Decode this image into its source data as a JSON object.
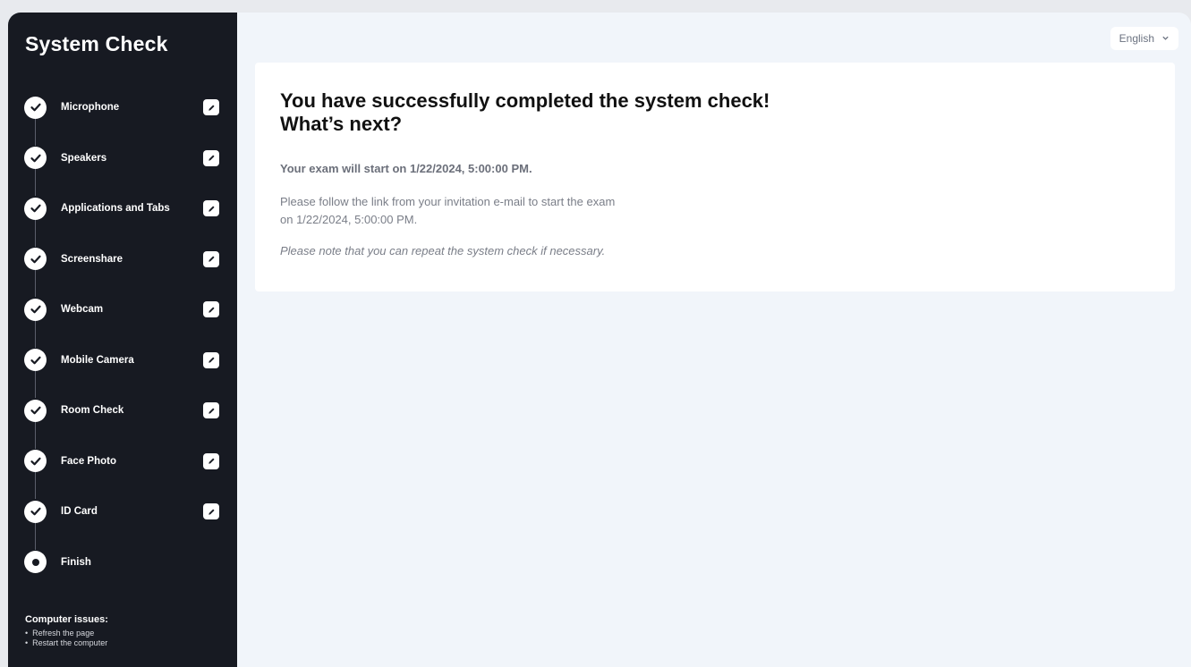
{
  "sidebar": {
    "title": "System Check",
    "steps": [
      {
        "label": "Microphone",
        "status": "done"
      },
      {
        "label": "Speakers",
        "status": "done"
      },
      {
        "label": "Applications and Tabs",
        "status": "done"
      },
      {
        "label": "Screenshare",
        "status": "done"
      },
      {
        "label": "Webcam",
        "status": "done"
      },
      {
        "label": "Mobile Camera",
        "status": "done"
      },
      {
        "label": "Room Check",
        "status": "done"
      },
      {
        "label": "Face Photo",
        "status": "done"
      },
      {
        "label": "ID Card",
        "status": "done"
      },
      {
        "label": "Finish",
        "status": "current"
      }
    ],
    "issues_title": "Computer issues:",
    "issues": [
      "Refresh the page",
      "Restart the computer"
    ]
  },
  "header": {
    "language": "English"
  },
  "main": {
    "heading_line1": "You have successfully completed the system check!",
    "heading_line2": "What’s next?",
    "start_text": "Your exam will start on 1/22/2024, 5:00:00 PM.",
    "follow_line1": "Please follow the link from your invitation e-mail to start the exam",
    "follow_line2": "on 1/22/2024, 5:00:00 PM.",
    "note": "Please note that you can repeat the system check if necessary."
  },
  "colors": {
    "sidebar_bg": "#171a22",
    "page_bg": "#f1f5fa",
    "card_bg": "#ffffff"
  }
}
